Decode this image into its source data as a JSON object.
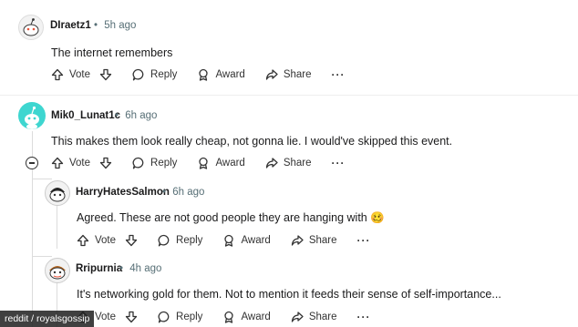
{
  "comments": [
    {
      "username": "DIraetz1",
      "time": "5h ago",
      "body": "The internet remembers",
      "actions": {
        "vote": "Vote",
        "reply": "Reply",
        "award": "Award",
        "share": "Share",
        "more": "···"
      }
    },
    {
      "username": "Mik0_Lunat1c",
      "time": "6h ago",
      "body": "This makes them look really cheap, not gonna lie. I would've skipped this event.",
      "actions": {
        "vote": "Vote",
        "reply": "Reply",
        "award": "Award",
        "share": "Share",
        "more": "···"
      }
    },
    {
      "username": "HarryHatesSalmon",
      "time": "6h ago",
      "body": "Agreed. These are not good people they are hanging with 🥴",
      "actions": {
        "vote": "Vote",
        "reply": "Reply",
        "award": "Award",
        "share": "Share",
        "more": "···"
      }
    },
    {
      "username": "Rripurnia",
      "time": "4h ago",
      "body": "It's networking gold for them. Not to mention it feeds their sense of self-importance...",
      "actions": {
        "vote": "Vote",
        "reply": "Reply",
        "award": "Award",
        "share": "Share",
        "more": "···"
      }
    }
  ],
  "separator": "•",
  "watermark": "reddit / royalsgossip",
  "colors": {
    "meta": "#576f76",
    "thread": "#dcdcdc",
    "avatar_teal": "#3ed6d0"
  }
}
